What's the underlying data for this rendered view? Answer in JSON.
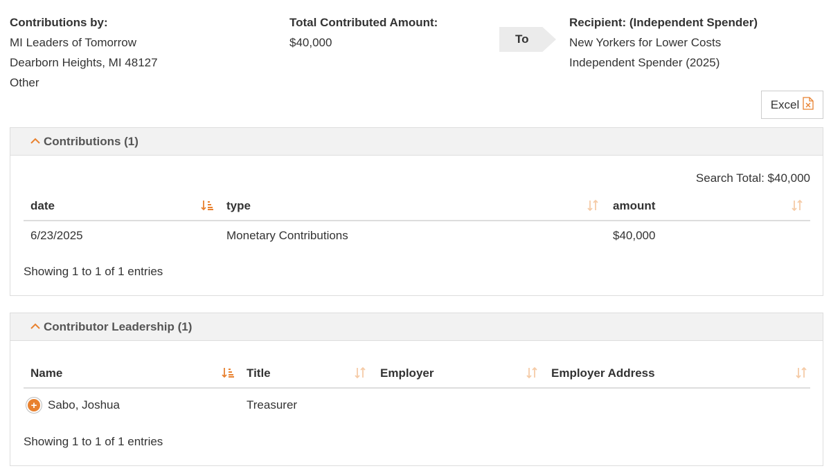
{
  "header": {
    "contributor_label": "Contributions by:",
    "contributor_name": "MI Leaders of Tomorrow",
    "contributor_city": "Dearborn Heights, MI 48127",
    "contributor_type": "Other",
    "total_label": "Total Contributed Amount:",
    "total_value": "$40,000",
    "to_label": "To",
    "recipient_label": "Recipient: (Independent Spender)",
    "recipient_name": "New Yorkers for Lower Costs",
    "recipient_type": "Independent Spender (2025)"
  },
  "excel": {
    "label": "Excel",
    "icon": "excel-file-icon"
  },
  "contributions": {
    "title": "Contributions (1)",
    "search_total": "Search Total: $40,000",
    "columns": [
      "date",
      "type",
      "amount"
    ],
    "rows": [
      {
        "date": "6/23/2025",
        "type": "Monetary Contributions",
        "amount": "$40,000"
      }
    ],
    "info": "Showing 1 to 1 of 1 entries"
  },
  "leadership": {
    "title": "Contributor Leadership (1)",
    "columns": [
      "Name",
      "Title",
      "Employer",
      "Employer Address"
    ],
    "rows": [
      {
        "name": "Sabo, Joshua",
        "title": "Treasurer",
        "employer": "",
        "employer_address": ""
      }
    ],
    "info": "Showing 1 to 1 of 1 entries"
  },
  "colors": {
    "accent": "#e8812f",
    "panel_header": "#f2f2f2",
    "border": "#dddddd"
  }
}
